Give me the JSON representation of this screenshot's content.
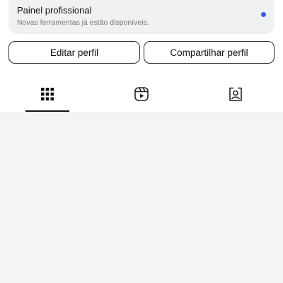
{
  "pro_dashboard": {
    "title": "Painel profissional",
    "subtitle": "Novas ferramentas já estão disponíveis.",
    "dot_color": "#3b5bf5"
  },
  "actions": {
    "edit_label": "Editar perfil",
    "share_label": "Compartilhar perfil"
  },
  "tabs": [
    {
      "icon": "grid-icon",
      "active": true
    },
    {
      "icon": "reels-icon",
      "active": false
    },
    {
      "icon": "tagged-icon",
      "active": false
    }
  ]
}
